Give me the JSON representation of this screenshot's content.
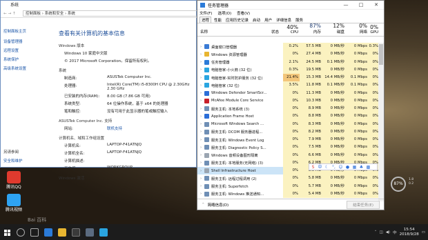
{
  "system": {
    "window_title": "系统",
    "breadcrumb": "控制面板 › 系统和安全 › 系统",
    "left_header": "控制面板主页",
    "left_links": [
      "设备管理器",
      "远程设置",
      "系统保护",
      "高级系统设置"
    ],
    "heading": "查看有关计算机的基本信息",
    "edition_section": "Windows 版本",
    "edition": "Windows 10 家庭中文版",
    "copyright": "© 2017 Microsoft Corporation。保留所有权利。",
    "system_section": "系统",
    "rows": [
      {
        "label": "制造商:",
        "value": "ASUSTek Computer Inc."
      },
      {
        "label": "处理器:",
        "value": "Intel(R) Core(TM) i5-8300H CPU @ 2.30GHz   2.30 GHz"
      },
      {
        "label": "已安装的内存(RAM):",
        "value": "8.00 GB (7.86 GB 可用)"
      },
      {
        "label": "系统类型:",
        "value": "64 位操作系统，基于 x64 的处理器"
      },
      {
        "label": "笔和触控:",
        "value": "没有可用于此显示器的笔或触控输入"
      }
    ],
    "support_section": "ASUSTek Computer Inc. 支持",
    "support_row": {
      "label": "网站:",
      "value": "联机支持"
    },
    "computer_section": "计算机名、域和工作组设置",
    "computer_rows": [
      {
        "label": "计算机名:",
        "value": "LAPTOP-F41ATNJQ"
      },
      {
        "label": "计算机全名:",
        "value": "LAPTOP-F41ATNJQ"
      },
      {
        "label": "计算机描述:",
        "value": ""
      },
      {
        "label": "工作组:",
        "value": "WORKGROUP"
      }
    ],
    "activation_section": "Windows 激活",
    "see_also": "另请参阅",
    "bottom_link": "安全和维护"
  },
  "taskmgr": {
    "title": "任务管理器",
    "window_controls": [
      "—",
      "□",
      "✕"
    ],
    "menu": [
      "文件(F)",
      "选项(O)",
      "查看(V)"
    ],
    "tabs": [
      "进程",
      "性能",
      "应用历史记录",
      "启动",
      "用户",
      "详细信息",
      "服务"
    ],
    "header": {
      "name": "名称",
      "status": "状态",
      "cpu_pct": "40%",
      "cpu": "CPU",
      "mem_pct": "87%",
      "mem": "内存",
      "disk_pct": "12%",
      "disk": "磁盘",
      "net_pct": "0%",
      "net": "网络",
      "gpu_pct": "0%",
      "gpu": "GPU"
    },
    "rows": [
      {
        "name": "桌面窗口管理器",
        "cpu": "0.2%",
        "mem": "57.5 MB",
        "disk": "0 MB/秒",
        "net": "0 Mbps",
        "gpu": "0.3%",
        "color": "#3a7bd5"
      },
      {
        "name": "Windows 资源管理器",
        "cpu": "0%",
        "mem": "27.4 MB",
        "disk": "0 MB/秒",
        "net": "0 Mbps",
        "gpu": "0%",
        "color": "#e8b530"
      },
      {
        "name": "任务管理器",
        "cpu": "2.1%",
        "mem": "24.5 MB",
        "disk": "0.1 MB/秒",
        "net": "0 Mbps",
        "gpu": "0%",
        "color": "#2b7bd8"
      },
      {
        "name": "电脑管家-小火箭 (32 位)",
        "cpu": "0.3%",
        "mem": "19.5 MB",
        "disk": "0 MB/秒",
        "net": "0 Mbps",
        "gpu": "0%",
        "color": "#2aa5e0"
      },
      {
        "name": "电脑管家-实时防护服务 (32 位)",
        "cpu": "21.4%",
        "mem": "15.3 MB",
        "disk": "14.4 MB/秒",
        "net": "0.1 Mbps",
        "gpu": "0%",
        "color": "#2aa5e0",
        "hot": true
      },
      {
        "name": "电脑管家 (32 位)",
        "cpu": "3.5%",
        "mem": "11.8 MB",
        "disk": "0.1 MB/秒",
        "net": "0.1 Mbps",
        "gpu": "0%",
        "color": "#2aa5e0"
      },
      {
        "name": "Windows Defender SmartScr...",
        "cpu": "0%",
        "mem": "11.3 MB",
        "disk": "0 MB/秒",
        "net": "0 Mbps",
        "gpu": "0%",
        "color": "#2b6ed8"
      },
      {
        "name": "McAfee Module Core Service",
        "cpu": "0%",
        "mem": "10.3 MB",
        "disk": "0 MB/秒",
        "net": "0 Mbps",
        "gpu": "0%",
        "color": "#c8202a"
      },
      {
        "name": "服务主机: 本地系统 (3)",
        "cpu": "0%",
        "mem": "8.9 MB",
        "disk": "0 MB/秒",
        "net": "0 Mbps",
        "gpu": "0%",
        "color": "#6f8fb5"
      },
      {
        "name": "Application Frame Host",
        "cpu": "0%",
        "mem": "8.8 MB",
        "disk": "0 MB/秒",
        "net": "0 Mbps",
        "gpu": "0%",
        "color": "#2b6ed8"
      },
      {
        "name": "Microsoft Windows Search ...",
        "cpu": "0%",
        "mem": "8.3 MB",
        "disk": "0 MB/秒",
        "net": "0 Mbps",
        "gpu": "0%",
        "color": "#6f8fb5"
      },
      {
        "name": "服务主机: DCOM 服务器进程...",
        "cpu": "0%",
        "mem": "8.2 MB",
        "disk": "0 MB/秒",
        "net": "0 Mbps",
        "gpu": "0%",
        "color": "#6f8fb5"
      },
      {
        "name": "服务主机: Windows Event Log",
        "cpu": "0%",
        "mem": "7.9 MB",
        "disk": "0 MB/秒",
        "net": "0 Mbps",
        "gpu": "0%",
        "color": "#6f8fb5"
      },
      {
        "name": "服务主机: Diagnostic Policy S...",
        "cpu": "0%",
        "mem": "7.5 MB",
        "disk": "0 MB/秒",
        "net": "0 Mbps",
        "gpu": "0%",
        "color": "#6f8fb5"
      },
      {
        "name": "Windows 音频设备图形隔离",
        "cpu": "0%",
        "mem": "6.6 MB",
        "disk": "0 MB/秒",
        "net": "0 Mbps",
        "gpu": "0%",
        "color": "#9aa5b1"
      },
      {
        "name": "服务主机: 本地服务(无网络) (3)",
        "cpu": "0%",
        "mem": "6.2 MB",
        "disk": "0 MB/秒",
        "net": "0 Mbps",
        "gpu": "0%",
        "color": "#6f8fb5"
      },
      {
        "name": "Shell Infrastructure Host",
        "cpu": "0%",
        "mem": "5.9 MB",
        "disk": "0 MB/秒",
        "net": "0 Mbps",
        "gpu": "0%",
        "color": "#9aa5b1",
        "selected": true
      },
      {
        "name": "服务主机: 远程过程调用 (2)",
        "cpu": "0%",
        "mem": "5.8 MB",
        "disk": "0 MB/秒",
        "net": "0 Mbps",
        "gpu": "0%",
        "color": "#6f8fb5"
      },
      {
        "name": "服务主机: Superfetch",
        "cpu": "0%",
        "mem": "5.7 MB",
        "disk": "0 MB/秒",
        "net": "0 Mbps",
        "gpu": "0%",
        "color": "#6f8fb5"
      },
      {
        "name": "服务主机: Windows 推送通知...",
        "cpu": "0%",
        "mem": "5.4 MB",
        "disk": "0 MB/秒",
        "net": "0 Mbps",
        "gpu": "0%",
        "color": "#6f8fb5"
      }
    ],
    "footer_less": "简略信息(D)",
    "end_task": "结束任务(E)"
  },
  "desktop": {
    "icons": [
      {
        "label": "腾讯QQ",
        "color": "#e03a2e"
      },
      {
        "label": "腾讯视频",
        "color": "#2ea3f2"
      }
    ],
    "gauge_pct": "87%",
    "gauge_info": [
      "1.8",
      "0.2"
    ]
  },
  "taskbar": {
    "time": "15:54",
    "date": "2018/9/28",
    "ime": "中",
    "watermark": "Bai 百科"
  },
  "colors": {
    "cpu_hot": "#f3c67a",
    "cell_bg": "#fbf2c0",
    "link": "#1a55a8",
    "heading": "#1e4f9a"
  }
}
